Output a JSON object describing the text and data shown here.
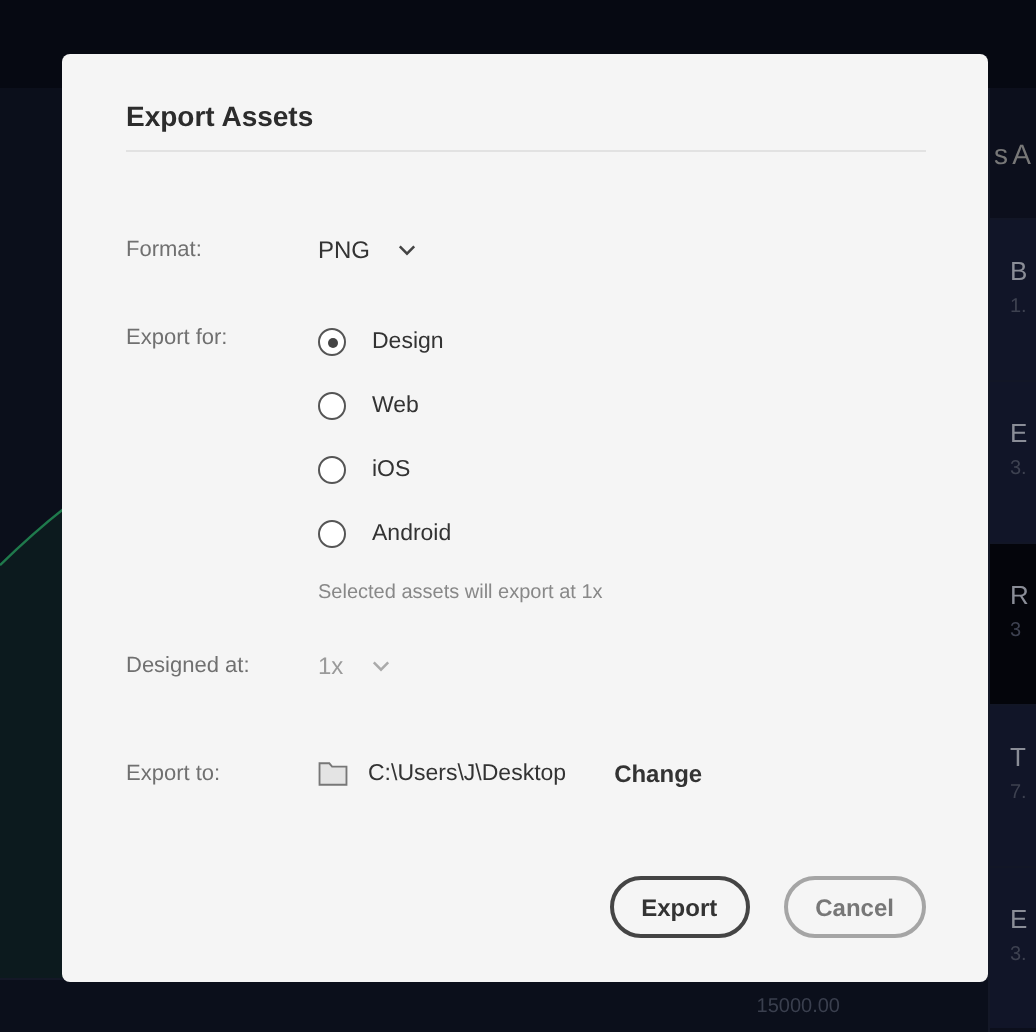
{
  "background": {
    "panel_heading": "s A",
    "items": [
      {
        "name": "B",
        "value": "1.",
        "selected": false
      },
      {
        "name": "E",
        "value": "3.",
        "selected": false
      },
      {
        "name": "R",
        "value": "3",
        "selected": true
      },
      {
        "name": "T",
        "value": "7.",
        "selected": false
      },
      {
        "name": "E",
        "value": "3.",
        "selected": false
      }
    ],
    "footer_value": "15000.00"
  },
  "dialog": {
    "title": "Export Assets",
    "format": {
      "label": "Format:",
      "value": "PNG"
    },
    "export_for": {
      "label": "Export for:",
      "options": [
        {
          "label": "Design",
          "selected": true
        },
        {
          "label": "Web",
          "selected": false
        },
        {
          "label": "iOS",
          "selected": false
        },
        {
          "label": "Android",
          "selected": false
        }
      ],
      "note": "Selected assets will export at 1x"
    },
    "designed_at": {
      "label": "Designed at:",
      "value": "1x",
      "disabled": true
    },
    "export_to": {
      "label": "Export to:",
      "path": "C:\\Users\\J\\Desktop",
      "change": "Change"
    },
    "buttons": [
      {
        "label": "Export",
        "kind": "primary"
      },
      {
        "label": "Cancel",
        "kind": "secondary"
      }
    ]
  }
}
